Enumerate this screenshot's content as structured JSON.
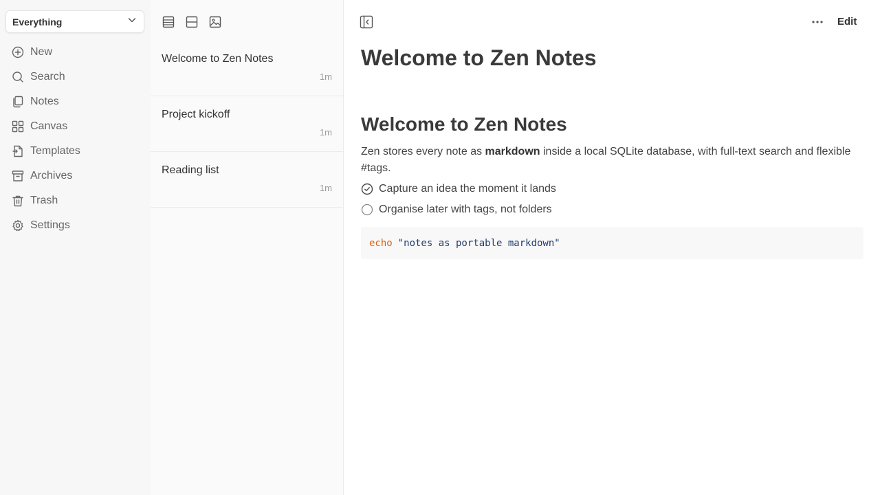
{
  "sidebar": {
    "scope": "Everything",
    "items": [
      {
        "label": "New",
        "icon": "plus-circle-icon"
      },
      {
        "label": "Search",
        "icon": "search-icon"
      },
      {
        "label": "Notes",
        "icon": "notes-icon"
      },
      {
        "label": "Canvas",
        "icon": "canvas-icon"
      },
      {
        "label": "Templates",
        "icon": "template-icon"
      },
      {
        "label": "Archives",
        "icon": "archive-icon"
      },
      {
        "label": "Trash",
        "icon": "trash-icon"
      },
      {
        "label": "Settings",
        "icon": "gear-icon"
      }
    ]
  },
  "list": {
    "items": [
      {
        "title": "Welcome to Zen Notes",
        "time": "1m"
      },
      {
        "title": "Project kickoff",
        "time": "1m"
      },
      {
        "title": "Reading list",
        "time": "1m"
      }
    ]
  },
  "main": {
    "edit_label": "Edit",
    "doc_title": "Welcome to Zen Notes",
    "heading": "Welcome to Zen Notes",
    "para_pre": "Zen stores every note as ",
    "para_bold": "markdown",
    "para_post": " inside a local SQLite database, with full-text search and flexible #tags.",
    "tasks": [
      {
        "text": "Capture an idea the moment it lands",
        "checked": true
      },
      {
        "text": "Organise later with tags, not folders",
        "checked": false
      }
    ],
    "code_keyword": "echo",
    "code_string": "\"notes as portable markdown\""
  },
  "colors": {
    "code_keyword": "#d9630b",
    "code_string": "#1e3a6e",
    "sidebar_bg": "#f7f7f7",
    "list_bg": "#fafafa"
  }
}
